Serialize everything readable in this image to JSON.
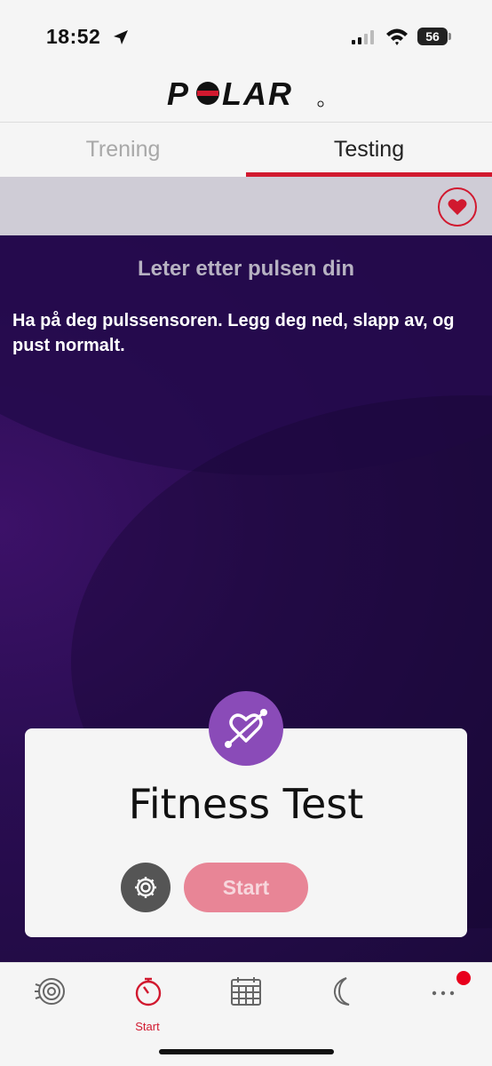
{
  "status_bar": {
    "time": "18:52",
    "battery": "56",
    "icons": [
      "location-arrow-icon",
      "cellular-signal-icon",
      "wifi-icon",
      "battery-icon"
    ]
  },
  "app": {
    "brand": "POLAR",
    "brand_color": "#d1192f"
  },
  "tabs": [
    {
      "label": "Trening",
      "active": false
    },
    {
      "label": "Testing",
      "active": true
    }
  ],
  "heart_rate_button": {
    "icon": "heart-icon"
  },
  "main": {
    "searching_title": "Leter etter pulsen din",
    "instruction": "Ha på deg pulssensoren. Legg deg ned, slapp av, og pust normalt."
  },
  "test_card": {
    "icon": "fitness-test-icon",
    "title": "Fitness Test",
    "settings_icon": "gear-icon",
    "start_label": "Start"
  },
  "bottom_nav": {
    "items": [
      {
        "icon": "activity-icon",
        "label": ""
      },
      {
        "icon": "stopwatch-icon",
        "label": "Start",
        "active": true
      },
      {
        "icon": "calendar-icon",
        "label": ""
      },
      {
        "icon": "moon-icon",
        "label": ""
      },
      {
        "icon": "more-icon",
        "label": "",
        "has_notification": true
      }
    ]
  }
}
